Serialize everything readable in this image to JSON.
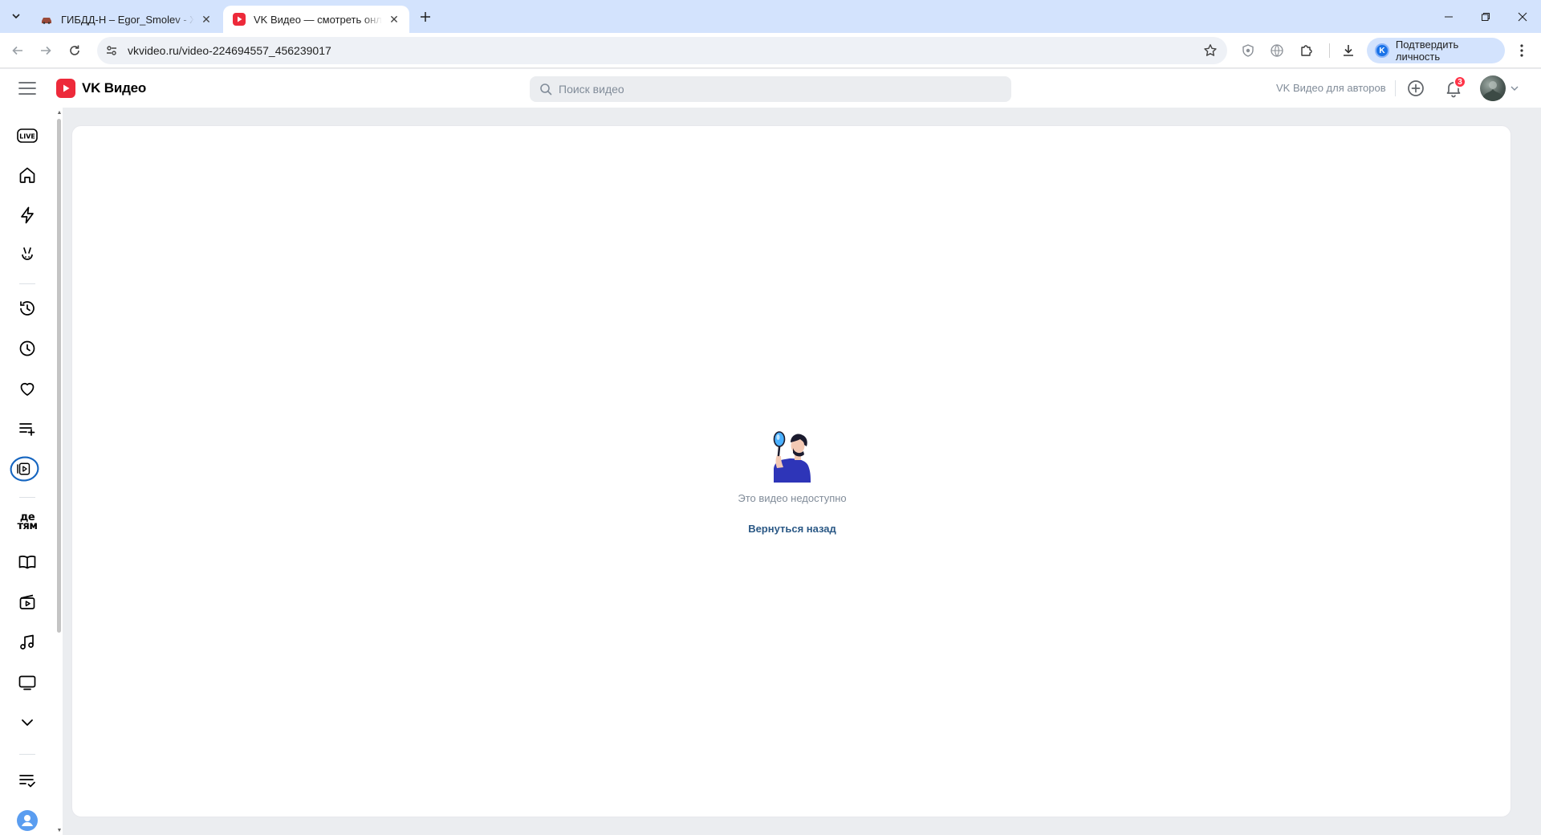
{
  "browser": {
    "tabs": [
      {
        "title": "ГИБДД-Н – Egor_Smolev - Жалоба",
        "active": false
      },
      {
        "title": "VK Видео — смотреть онлайн",
        "active": true
      }
    ],
    "address": "vkvideo.ru/video-224694557_456239017",
    "verify_label": "Подтвердить личность",
    "verify_initial": "K"
  },
  "header": {
    "logo_text": "VK Видео",
    "search_placeholder": "Поиск видео",
    "for_authors": "VK Видео для авторов",
    "notifications_count": "3"
  },
  "sidebar": {
    "items": [
      {
        "name": "live",
        "icon": "live-icon"
      },
      {
        "name": "home",
        "icon": "home-icon"
      },
      {
        "name": "trending",
        "icon": "lightning-icon"
      },
      {
        "name": "clips",
        "icon": "clips-icon"
      },
      {
        "name": "history",
        "icon": "history-icon"
      },
      {
        "name": "watch-later",
        "icon": "clock-icon"
      },
      {
        "name": "liked",
        "icon": "heart-icon"
      },
      {
        "name": "playlists",
        "icon": "playlist-add-icon"
      },
      {
        "name": "my-videos",
        "icon": "my-videos-icon"
      },
      {
        "name": "kids",
        "icon": "kids-icon",
        "label_top": "де",
        "label_bottom": "тям"
      },
      {
        "name": "education",
        "icon": "book-icon"
      },
      {
        "name": "films",
        "icon": "film-icon"
      },
      {
        "name": "music",
        "icon": "music-icon"
      },
      {
        "name": "tv",
        "icon": "tv-icon"
      },
      {
        "name": "more",
        "icon": "chevron-down-icon"
      },
      {
        "name": "subscriptions",
        "icon": "list-check-icon"
      },
      {
        "name": "profile",
        "icon": "user-icon"
      }
    ]
  },
  "main": {
    "message": "Это видео недоступно",
    "back_link": "Вернуться назад"
  },
  "colors": {
    "accent": "#2a5885",
    "brand_red": "#ed2a3a",
    "muted_text": "#818c99",
    "page_bg": "#ebedf0"
  }
}
